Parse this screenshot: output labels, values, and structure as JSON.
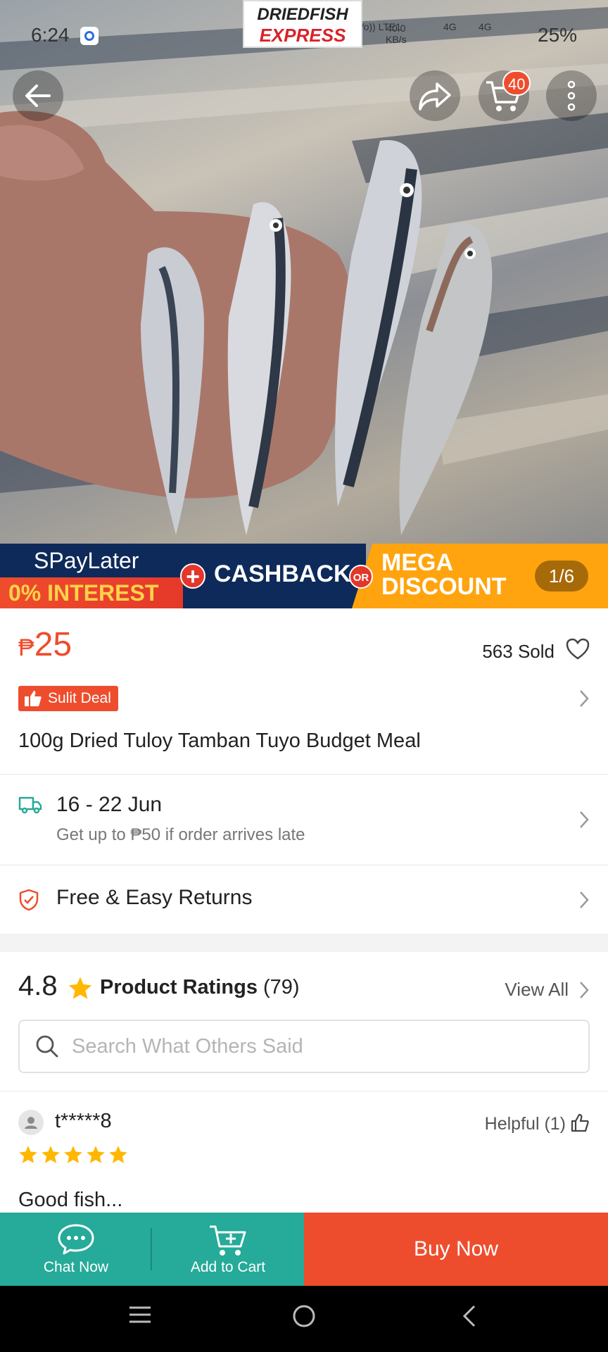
{
  "status_bar": {
    "time": "6:24",
    "network_speed": "40.0",
    "network_unit": "KB/s",
    "volte": "Vo)) LTE1",
    "sig1": "4G",
    "sig2": "4G",
    "battery": "25%"
  },
  "brand": {
    "line1": "DRIEDFISH",
    "line2": "EXPRESS"
  },
  "cart": {
    "badge_count": "40"
  },
  "promo_banner": {
    "spaylater": "SPayLater",
    "interest": "0% INTEREST",
    "plus": "+",
    "cashback": "CASHBACK",
    "or": "OR",
    "mega": "MEGA",
    "discount": "DISCOUNT"
  },
  "gallery": {
    "counter": "1/6"
  },
  "product": {
    "currency": "₱",
    "price": "25",
    "sold": "563 Sold",
    "deal_badge": "Sulit Deal",
    "title": "100g Dried Tuloy Tamban Tuyo Budget Meal"
  },
  "shipping": {
    "dates": "16 - 22 Jun",
    "guarantee": "Get up to ₱50 if order arrives late"
  },
  "returns": {
    "label": "Free & Easy Returns"
  },
  "ratings": {
    "score": "4.8",
    "label": "Product Ratings",
    "count": "(79)",
    "view_all": "View All",
    "search_placeholder": "Search What Others Said"
  },
  "review": {
    "username": "t*****8",
    "helpful": "Helpful (1)",
    "stars": 5,
    "text": "Good fish..."
  },
  "actions": {
    "chat": "Chat Now",
    "add_to_cart": "Add to Cart",
    "buy_now": "Buy Now"
  },
  "colors": {
    "accent": "#ee4d2d",
    "teal": "#26aa99",
    "star": "#ffb700",
    "banner_navy": "#0e2a5a",
    "banner_orange": "#ffa40f"
  }
}
